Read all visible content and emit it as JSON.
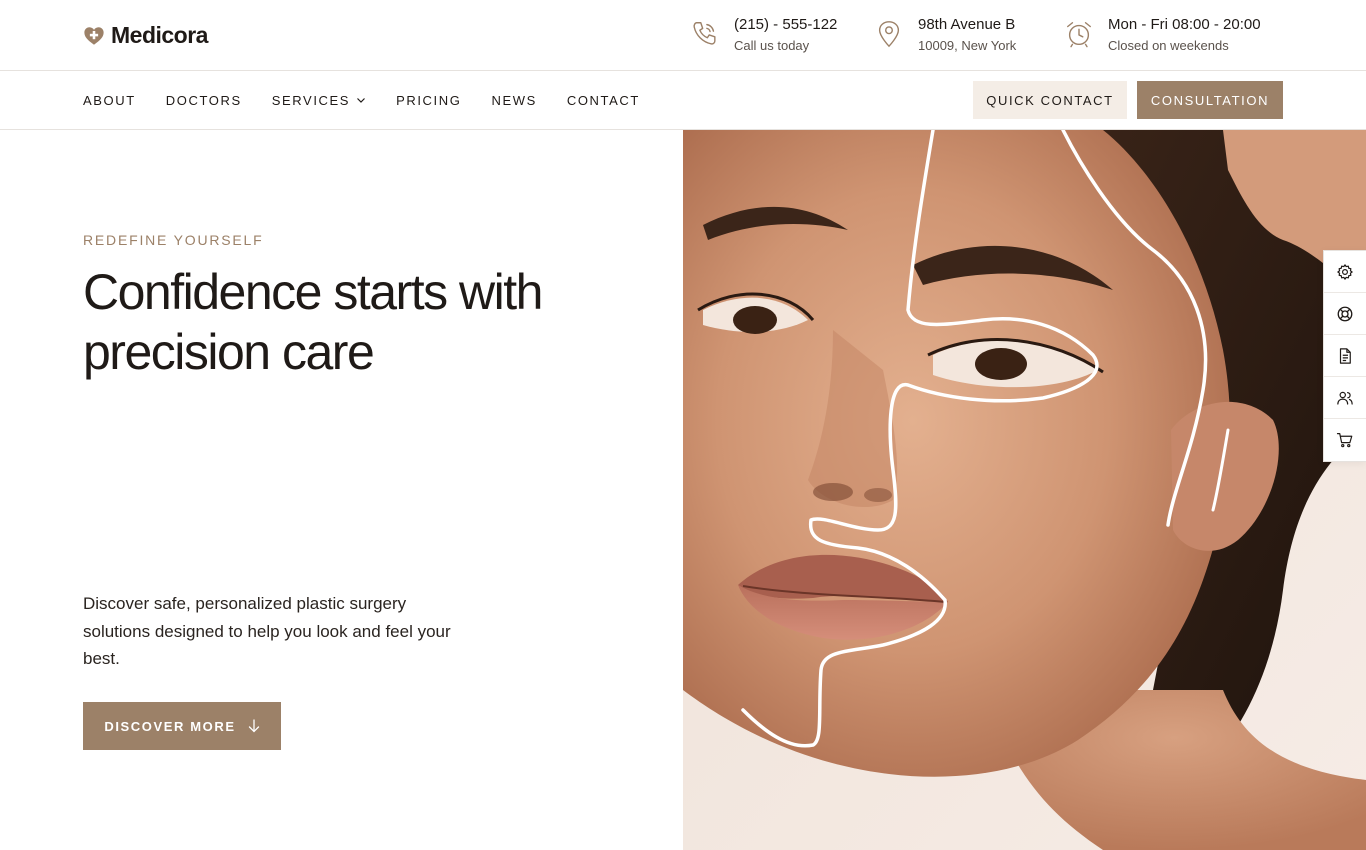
{
  "brand": {
    "name": "Medicora",
    "accent": "#9c8168",
    "accent_light": "#f4ede6",
    "text": "#1f1a17"
  },
  "contact_info": [
    {
      "icon": "phone-icon",
      "line1": "(215) - 555-122",
      "line2": "Call us today"
    },
    {
      "icon": "map-pin-icon",
      "line1": "98th Avenue B",
      "line2": "10009, New York"
    },
    {
      "icon": "alarm-clock-icon",
      "line1": "Mon - Fri 08:00 - 20:00",
      "line2": "Closed on weekends"
    }
  ],
  "nav": {
    "items": [
      "ABOUT",
      "DOCTORS",
      "SERVICES",
      "PRICING",
      "NEWS",
      "CONTACT"
    ],
    "quick_contact": "QUICK CONTACT",
    "consultation": "CONSULTATION"
  },
  "hero": {
    "eyebrow": "REDEFINE YOURSELF",
    "headline_highlight": "Confidence",
    "headline_rest": " starts with precision care",
    "lede": "Discover safe, personalized plastic surgery solutions designed to help you look and feel your best.",
    "cta": "DISCOVER MORE"
  },
  "sidebar_icons": [
    "settings-gear-icon",
    "lifebuoy-icon",
    "document-icon",
    "users-icon",
    "cart-icon"
  ]
}
